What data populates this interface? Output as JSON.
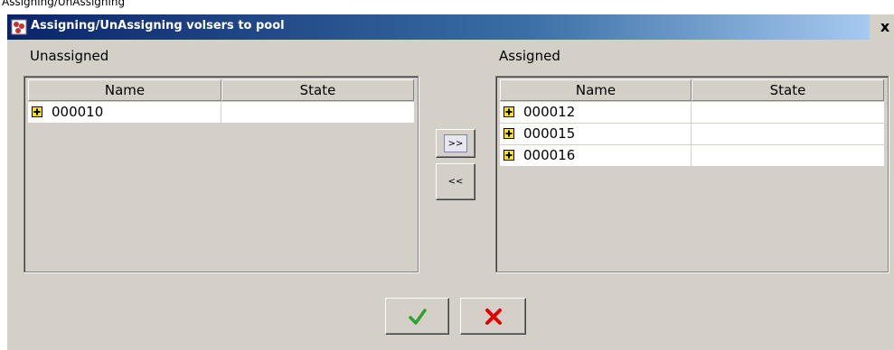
{
  "background_title": "Assigning/UnAssigning",
  "window": {
    "title": "Assigning/UnAssigning volsers to pool",
    "close_label": "x"
  },
  "unassigned": {
    "label": "Unassigned",
    "columns": [
      "Name",
      "State"
    ],
    "rows": [
      {
        "name": "000010",
        "state": ""
      }
    ]
  },
  "assigned": {
    "label": "Assigned",
    "columns": [
      "Name",
      "State"
    ],
    "rows": [
      {
        "name": "000012",
        "state": ""
      },
      {
        "name": "000015",
        "state": ""
      },
      {
        "name": "000016",
        "state": ""
      }
    ]
  },
  "buttons": {
    "move_right": ">>",
    "move_left": "<<",
    "ok_icon": "checkmark-icon",
    "cancel_icon": "red-x-icon"
  },
  "colors": {
    "titlebar_start": "#0a246a",
    "titlebar_end": "#a6caf0",
    "dialog_bg": "#d4d0c8",
    "ok_green": "#2ea02e",
    "cancel_red": "#e00000",
    "volser_icon_yellow": "#ffe400"
  }
}
